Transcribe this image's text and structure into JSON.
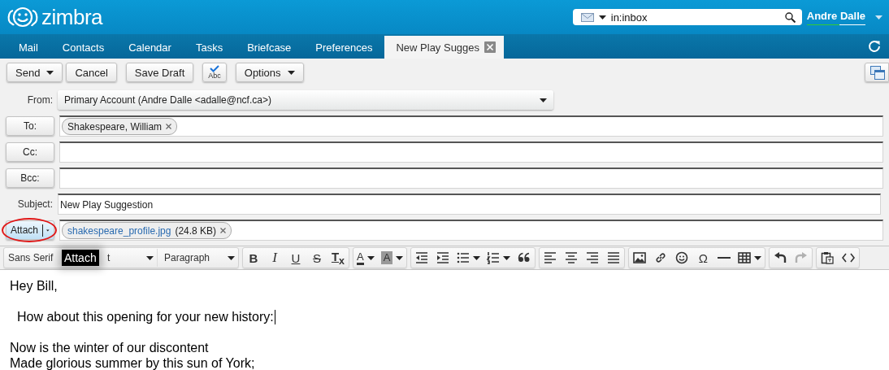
{
  "header": {
    "logo_text": "zimbra",
    "search": {
      "value": "in:inbox"
    },
    "user": {
      "name": "Andre Dalle"
    }
  },
  "tabs": [
    {
      "label": "Mail",
      "selected": false,
      "closable": false
    },
    {
      "label": "Contacts",
      "selected": false,
      "closable": false
    },
    {
      "label": "Calendar",
      "selected": false,
      "closable": false
    },
    {
      "label": "Tasks",
      "selected": false,
      "closable": false
    },
    {
      "label": "Briefcase",
      "selected": false,
      "closable": false
    },
    {
      "label": "Preferences",
      "selected": false,
      "closable": false
    },
    {
      "label": "New Play Sugges",
      "selected": true,
      "closable": true
    }
  ],
  "toolbar": {
    "buttons": [
      {
        "kind": "text",
        "label": "Send",
        "has_menu": true
      },
      {
        "kind": "text",
        "label": "Cancel",
        "has_menu": false
      },
      {
        "kind": "text",
        "label": "Save Draft",
        "has_menu": false
      },
      {
        "kind": "spellcheck",
        "label": "Abc"
      },
      {
        "kind": "text",
        "label": "Options",
        "has_menu": true
      }
    ]
  },
  "compose": {
    "from": {
      "label": "From:",
      "value": "Primary Account (Andre Dalle <adalle@ncf.ca>)"
    },
    "recipients": [
      {
        "label": "To:",
        "chips": [
          {
            "text": "Shakespeare, William"
          }
        ]
      },
      {
        "label": "Cc:"
      },
      {
        "label": "Bcc:"
      }
    ],
    "subject": {
      "label": "Subject:",
      "value": "New Play Suggestion"
    },
    "attach": {
      "label": "Attach",
      "hover": true,
      "circled": true,
      "files": [
        {
          "name": "shakespeare_profile.jpg",
          "size": "(24.8 KB)"
        }
      ]
    }
  },
  "editor": {
    "font_family": "Sans Serif",
    "font_size": "t",
    "block_format": "Paragraph",
    "tooltip": "Attach",
    "groups": [
      [
        {
          "kind": "bold",
          "label": "B",
          "has_menu": false,
          "disabled": false
        },
        {
          "kind": "italic",
          "label": "I",
          "has_menu": false,
          "disabled": false
        },
        {
          "kind": "underline",
          "label": "U",
          "has_menu": false,
          "disabled": false
        },
        {
          "kind": "strike",
          "label": "S",
          "has_menu": false,
          "disabled": false
        },
        {
          "kind": "clear",
          "label": "T$_{x}$",
          "has_menu": false,
          "disabled": false
        }
      ],
      [
        {
          "kind": "forecolor",
          "label": "A",
          "has_menu": true,
          "disabled": false
        },
        {
          "kind": "backcolor",
          "label": "A",
          "has_menu": true,
          "disabled": false
        }
      ],
      [
        {
          "kind": "outdent",
          "has_menu": false,
          "disabled": false
        },
        {
          "kind": "indent",
          "has_menu": false,
          "disabled": false
        },
        {
          "kind": "bullets",
          "has_menu": true,
          "disabled": false
        },
        {
          "kind": "numbers",
          "has_menu": true,
          "disabled": false
        },
        {
          "kind": "quote",
          "has_menu": false,
          "disabled": false
        }
      ],
      [
        {
          "kind": "align-left",
          "has_menu": false,
          "disabled": false
        },
        {
          "kind": "align-center",
          "has_menu": false,
          "disabled": false
        },
        {
          "kind": "align-right",
          "has_menu": false,
          "disabled": false
        },
        {
          "kind": "justify",
          "has_menu": false,
          "disabled": false
        }
      ],
      [
        {
          "kind": "image",
          "has_menu": false,
          "disabled": false
        },
        {
          "kind": "link",
          "has_menu": false,
          "disabled": false
        },
        {
          "kind": "emoji",
          "has_menu": false,
          "disabled": false
        },
        {
          "kind": "charmap",
          "label": "Ω",
          "has_menu": false,
          "disabled": false
        },
        {
          "kind": "hr",
          "has_menu": false,
          "disabled": false
        },
        {
          "kind": "table",
          "has_menu": true,
          "disabled": false
        }
      ],
      [
        {
          "kind": "undo",
          "has_menu": false,
          "disabled": false
        },
        {
          "kind": "redo",
          "has_menu": false,
          "disabled": true
        }
      ],
      [
        {
          "kind": "paste",
          "has_menu": false,
          "disabled": false
        },
        {
          "kind": "code",
          "has_menu": false,
          "disabled": false
        }
      ]
    ],
    "paragraphs": [
      {
        "text": "Hey Bill,",
        "indented": false,
        "has_cursor": false
      },
      {
        "text": "How about this opening for your new history:",
        "indented": true,
        "has_cursor": true
      },
      {
        "text": "Now is the winter of our discontent",
        "indented": false,
        "has_cursor": false
      },
      {
        "text": "Made glorious summer by this sun of York;",
        "indented": false,
        "has_cursor": false
      }
    ]
  }
}
